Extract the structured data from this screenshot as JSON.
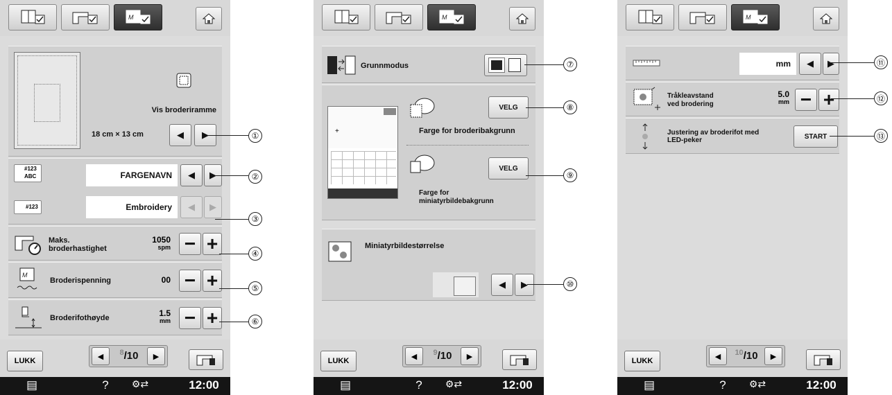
{
  "screens": [
    {
      "page": {
        "current": "8",
        "total": "10"
      },
      "close_label": "LUKK",
      "time": "12:00",
      "frame": {
        "label": "Vis broderiramme",
        "size_w": "18 cm",
        "size_sep": "×",
        "size_h": "13 cm"
      },
      "color_name": {
        "value": "FARGENAVN",
        "icon_top": "#123",
        "icon_bottom": "ABC"
      },
      "thread_number": {
        "value": "Embroidery",
        "icon": "#123"
      },
      "max_speed": {
        "label_1": "Maks.",
        "label_2": "broderhastighet",
        "value": "1050",
        "unit": "spm"
      },
      "tension": {
        "label": "Broderispenning",
        "value": "00"
      },
      "foot_height": {
        "label": "Broderifothøyde",
        "value": "1.5",
        "unit": "mm"
      }
    },
    {
      "page": {
        "current": "9",
        "total": "10"
      },
      "close_label": "LUKK",
      "time": "12:00",
      "base_mode": {
        "label": "Grunnmodus"
      },
      "bg_color": {
        "label": "Farge for broderibakgrunn",
        "button": "VELG"
      },
      "thumb_bg_color": {
        "label_1": "Farge for",
        "label_2": "miniatyrbildebakgrunn",
        "button": "VELG"
      },
      "thumb_size": {
        "label": "Miniatyrbildestørrelse"
      }
    },
    {
      "page": {
        "current": "10",
        "total": "10"
      },
      "close_label": "LUKK",
      "time": "12:00",
      "units": {
        "value": "mm"
      },
      "clearance": {
        "label_1": "Tråkleavstand",
        "label_2": "ved brodering",
        "value": "5.0",
        "unit": "mm"
      },
      "led_align": {
        "label_1": "Justering av broderifot med",
        "label_2": "LED-peker",
        "button": "START"
      }
    }
  ],
  "callouts": [
    "①",
    "②",
    "③",
    "④",
    "⑤",
    "⑥",
    "⑦",
    "⑧",
    "⑨",
    "⑩",
    "⑪",
    "⑫",
    "⑬"
  ],
  "colors": {
    "screen_bg": "#dcdcdc",
    "status_bar": "#151515",
    "active_tab": "#3a3a3a"
  }
}
